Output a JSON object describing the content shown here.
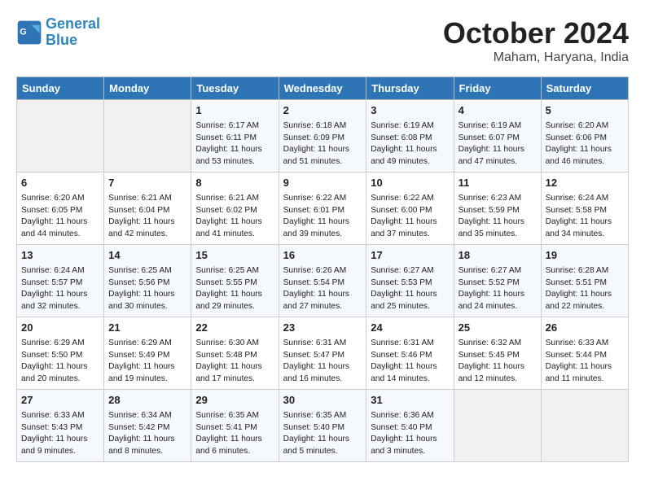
{
  "header": {
    "logo_line1": "General",
    "logo_line2": "Blue",
    "month": "October 2024",
    "location": "Maham, Haryana, India"
  },
  "days_of_week": [
    "Sunday",
    "Monday",
    "Tuesday",
    "Wednesday",
    "Thursday",
    "Friday",
    "Saturday"
  ],
  "weeks": [
    [
      {
        "day": "",
        "sunrise": "",
        "sunset": "",
        "daylight": ""
      },
      {
        "day": "",
        "sunrise": "",
        "sunset": "",
        "daylight": ""
      },
      {
        "day": "1",
        "sunrise": "Sunrise: 6:17 AM",
        "sunset": "Sunset: 6:11 PM",
        "daylight": "Daylight: 11 hours and 53 minutes."
      },
      {
        "day": "2",
        "sunrise": "Sunrise: 6:18 AM",
        "sunset": "Sunset: 6:09 PM",
        "daylight": "Daylight: 11 hours and 51 minutes."
      },
      {
        "day": "3",
        "sunrise": "Sunrise: 6:19 AM",
        "sunset": "Sunset: 6:08 PM",
        "daylight": "Daylight: 11 hours and 49 minutes."
      },
      {
        "day": "4",
        "sunrise": "Sunrise: 6:19 AM",
        "sunset": "Sunset: 6:07 PM",
        "daylight": "Daylight: 11 hours and 47 minutes."
      },
      {
        "day": "5",
        "sunrise": "Sunrise: 6:20 AM",
        "sunset": "Sunset: 6:06 PM",
        "daylight": "Daylight: 11 hours and 46 minutes."
      }
    ],
    [
      {
        "day": "6",
        "sunrise": "Sunrise: 6:20 AM",
        "sunset": "Sunset: 6:05 PM",
        "daylight": "Daylight: 11 hours and 44 minutes."
      },
      {
        "day": "7",
        "sunrise": "Sunrise: 6:21 AM",
        "sunset": "Sunset: 6:04 PM",
        "daylight": "Daylight: 11 hours and 42 minutes."
      },
      {
        "day": "8",
        "sunrise": "Sunrise: 6:21 AM",
        "sunset": "Sunset: 6:02 PM",
        "daylight": "Daylight: 11 hours and 41 minutes."
      },
      {
        "day": "9",
        "sunrise": "Sunrise: 6:22 AM",
        "sunset": "Sunset: 6:01 PM",
        "daylight": "Daylight: 11 hours and 39 minutes."
      },
      {
        "day": "10",
        "sunrise": "Sunrise: 6:22 AM",
        "sunset": "Sunset: 6:00 PM",
        "daylight": "Daylight: 11 hours and 37 minutes."
      },
      {
        "day": "11",
        "sunrise": "Sunrise: 6:23 AM",
        "sunset": "Sunset: 5:59 PM",
        "daylight": "Daylight: 11 hours and 35 minutes."
      },
      {
        "day": "12",
        "sunrise": "Sunrise: 6:24 AM",
        "sunset": "Sunset: 5:58 PM",
        "daylight": "Daylight: 11 hours and 34 minutes."
      }
    ],
    [
      {
        "day": "13",
        "sunrise": "Sunrise: 6:24 AM",
        "sunset": "Sunset: 5:57 PM",
        "daylight": "Daylight: 11 hours and 32 minutes."
      },
      {
        "day": "14",
        "sunrise": "Sunrise: 6:25 AM",
        "sunset": "Sunset: 5:56 PM",
        "daylight": "Daylight: 11 hours and 30 minutes."
      },
      {
        "day": "15",
        "sunrise": "Sunrise: 6:25 AM",
        "sunset": "Sunset: 5:55 PM",
        "daylight": "Daylight: 11 hours and 29 minutes."
      },
      {
        "day": "16",
        "sunrise": "Sunrise: 6:26 AM",
        "sunset": "Sunset: 5:54 PM",
        "daylight": "Daylight: 11 hours and 27 minutes."
      },
      {
        "day": "17",
        "sunrise": "Sunrise: 6:27 AM",
        "sunset": "Sunset: 5:53 PM",
        "daylight": "Daylight: 11 hours and 25 minutes."
      },
      {
        "day": "18",
        "sunrise": "Sunrise: 6:27 AM",
        "sunset": "Sunset: 5:52 PM",
        "daylight": "Daylight: 11 hours and 24 minutes."
      },
      {
        "day": "19",
        "sunrise": "Sunrise: 6:28 AM",
        "sunset": "Sunset: 5:51 PM",
        "daylight": "Daylight: 11 hours and 22 minutes."
      }
    ],
    [
      {
        "day": "20",
        "sunrise": "Sunrise: 6:29 AM",
        "sunset": "Sunset: 5:50 PM",
        "daylight": "Daylight: 11 hours and 20 minutes."
      },
      {
        "day": "21",
        "sunrise": "Sunrise: 6:29 AM",
        "sunset": "Sunset: 5:49 PM",
        "daylight": "Daylight: 11 hours and 19 minutes."
      },
      {
        "day": "22",
        "sunrise": "Sunrise: 6:30 AM",
        "sunset": "Sunset: 5:48 PM",
        "daylight": "Daylight: 11 hours and 17 minutes."
      },
      {
        "day": "23",
        "sunrise": "Sunrise: 6:31 AM",
        "sunset": "Sunset: 5:47 PM",
        "daylight": "Daylight: 11 hours and 16 minutes."
      },
      {
        "day": "24",
        "sunrise": "Sunrise: 6:31 AM",
        "sunset": "Sunset: 5:46 PM",
        "daylight": "Daylight: 11 hours and 14 minutes."
      },
      {
        "day": "25",
        "sunrise": "Sunrise: 6:32 AM",
        "sunset": "Sunset: 5:45 PM",
        "daylight": "Daylight: 11 hours and 12 minutes."
      },
      {
        "day": "26",
        "sunrise": "Sunrise: 6:33 AM",
        "sunset": "Sunset: 5:44 PM",
        "daylight": "Daylight: 11 hours and 11 minutes."
      }
    ],
    [
      {
        "day": "27",
        "sunrise": "Sunrise: 6:33 AM",
        "sunset": "Sunset: 5:43 PM",
        "daylight": "Daylight: 11 hours and 9 minutes."
      },
      {
        "day": "28",
        "sunrise": "Sunrise: 6:34 AM",
        "sunset": "Sunset: 5:42 PM",
        "daylight": "Daylight: 11 hours and 8 minutes."
      },
      {
        "day": "29",
        "sunrise": "Sunrise: 6:35 AM",
        "sunset": "Sunset: 5:41 PM",
        "daylight": "Daylight: 11 hours and 6 minutes."
      },
      {
        "day": "30",
        "sunrise": "Sunrise: 6:35 AM",
        "sunset": "Sunset: 5:40 PM",
        "daylight": "Daylight: 11 hours and 5 minutes."
      },
      {
        "day": "31",
        "sunrise": "Sunrise: 6:36 AM",
        "sunset": "Sunset: 5:40 PM",
        "daylight": "Daylight: 11 hours and 3 minutes."
      },
      {
        "day": "",
        "sunrise": "",
        "sunset": "",
        "daylight": ""
      },
      {
        "day": "",
        "sunrise": "",
        "sunset": "",
        "daylight": ""
      }
    ]
  ]
}
